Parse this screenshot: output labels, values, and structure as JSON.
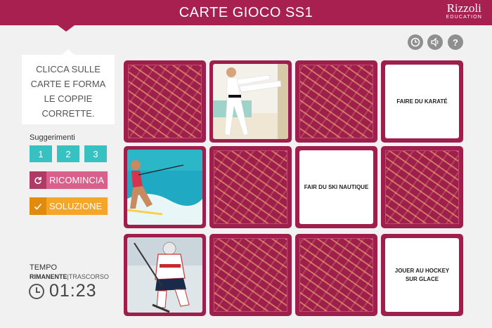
{
  "header": {
    "title": "CARTE GIOCO SS1",
    "brand_name": "Rizzoli",
    "brand_sub": "EDUCATION"
  },
  "toolbar": {
    "timer_icon": "clock-icon",
    "audio_icon": "speaker-icon",
    "help_label": "?"
  },
  "instructions": {
    "line1": "CLICCA SULLE",
    "line2": "CARTE E FORMA",
    "line3": "LE COPPIE",
    "line4": "CORRETTE."
  },
  "hints": {
    "label": "Suggerimenti",
    "buttons": [
      "1",
      "2",
      "3"
    ]
  },
  "actions": {
    "restart_label": "RICOMINCIA",
    "solution_label": "SOLUZIONE"
  },
  "timer": {
    "title": "TEMPO",
    "remaining": "RIMANENTE",
    "separator": "|",
    "elapsed": "TRASCORSO",
    "value": "01:23"
  },
  "cards": {
    "karate_text": "FAIRE DU KARATÉ",
    "ski_text": "FAIR DU SKI NAUTIQUE",
    "hockey_text_line1": "JOUER AU HOCKEY",
    "hockey_text_line2": "SUR GLACE"
  },
  "colors": {
    "primary": "#a8204f",
    "card_back": "#9e1f4b",
    "hint": "#37c1c1",
    "restart": "#d8608b",
    "solution": "#f5a52a"
  }
}
